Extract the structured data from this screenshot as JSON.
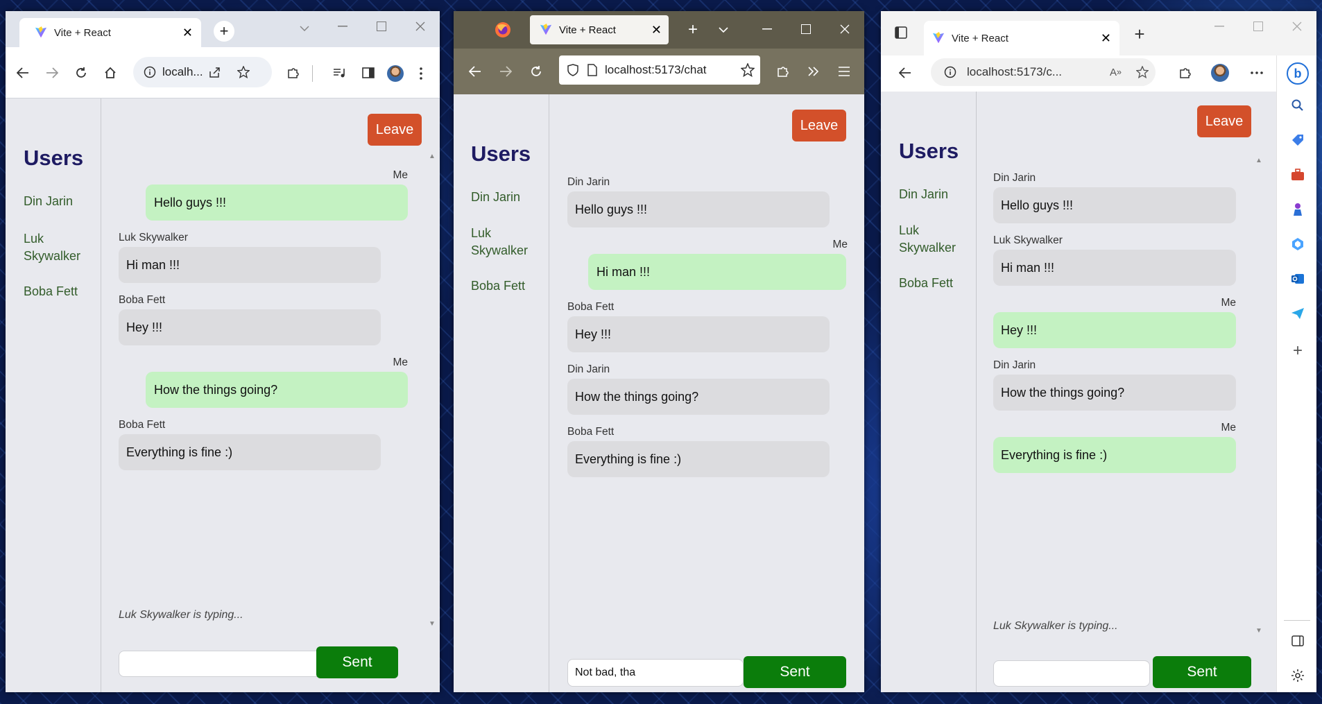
{
  "chrome": {
    "tab_title": "Vite + React",
    "url_truncated": "localh...",
    "url_firefox": "localhost:5173/chat",
    "url_edge": "localhost:5173/c..."
  },
  "app": {
    "users_title": "Users",
    "users": [
      "Din Jarin",
      "Luk Skywalker",
      "Boba Fett"
    ],
    "leave_label": "Leave",
    "send_label": "Sent",
    "me_label": "Me"
  },
  "windows": {
    "chrome": {
      "messages": [
        {
          "sender": "Me",
          "text": "Hello guys !!!",
          "mine": true
        },
        {
          "sender": "Luk Skywalker",
          "text": "Hi man !!!",
          "mine": false
        },
        {
          "sender": "Boba Fett",
          "text": "Hey !!!",
          "mine": false
        },
        {
          "sender": "Me",
          "text": "How the things going?",
          "mine": true
        },
        {
          "sender": "Boba Fett",
          "text": "Everything is fine :)",
          "mine": false
        }
      ],
      "typing": "Luk Skywalker is typing...",
      "input_value": ""
    },
    "firefox": {
      "messages": [
        {
          "sender": "Din Jarin",
          "text": "Hello guys !!!",
          "mine": false
        },
        {
          "sender": "Me",
          "text": "Hi man !!!",
          "mine": true
        },
        {
          "sender": "Boba Fett",
          "text": "Hey !!!",
          "mine": false
        },
        {
          "sender": "Din Jarin",
          "text": "How the things going?",
          "mine": false
        },
        {
          "sender": "Boba Fett",
          "text": "Everything is fine :)",
          "mine": false
        }
      ],
      "typing": "",
      "input_value": "Not bad, tha"
    },
    "edge": {
      "messages": [
        {
          "sender": "Din Jarin",
          "text": "Hello guys !!!",
          "mine": false
        },
        {
          "sender": "Luk Skywalker",
          "text": "Hi man !!!",
          "mine": false
        },
        {
          "sender": "Me",
          "text": "Hey !!!",
          "mine": true
        },
        {
          "sender": "Din Jarin",
          "text": "How the things going?",
          "mine": false
        },
        {
          "sender": "Me",
          "text": "Everything is fine :)",
          "mine": true
        }
      ],
      "typing": "Luk Skywalker is typing...",
      "input_value": ""
    }
  },
  "icons": {
    "vite": "vite-logo-icon",
    "firefox": "firefox-logo-icon",
    "profile": "avatar",
    "bing": "bing-copilot-icon"
  },
  "colors": {
    "leave": "#d3502a",
    "sent": "#0b7d0b",
    "mine_bubble": "#c4f2c2",
    "other_bubble": "#dcdcdf",
    "users_title": "#1e1b62",
    "user_link": "#325c2a"
  }
}
